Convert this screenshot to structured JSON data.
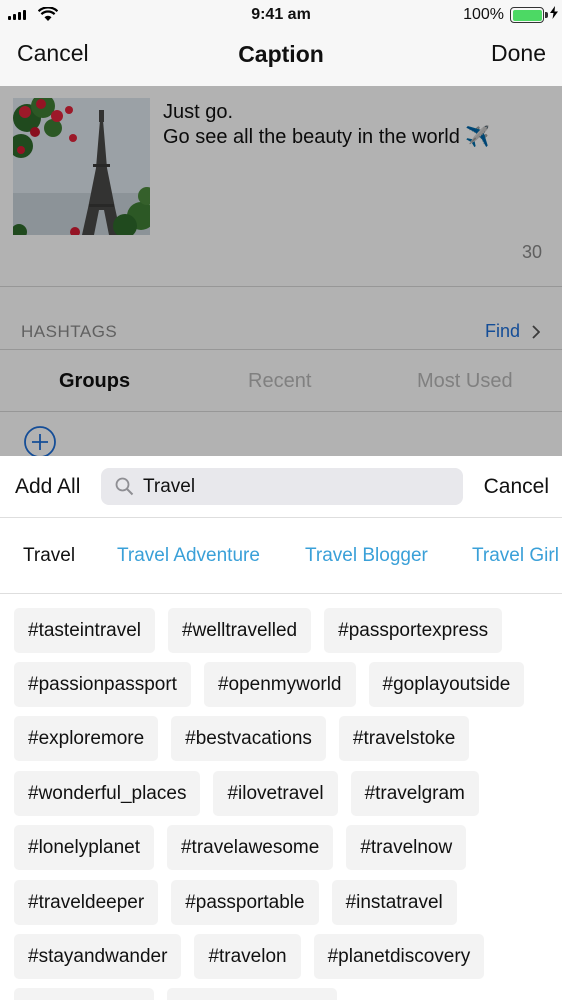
{
  "status_bar": {
    "time": "9:41 am",
    "battery_percent": "100%",
    "battery_level": 1.0
  },
  "nav": {
    "cancel_label": "Cancel",
    "title": "Caption",
    "done_label": "Done"
  },
  "caption": {
    "lines": [
      "Just go.",
      "Go see all the beauty in the world ✈️"
    ],
    "char_count": "30"
  },
  "hashtags_section": {
    "label": "HASHTAGS",
    "find_label": "Find",
    "tabs": [
      "Groups",
      "Recent",
      "Most Used"
    ],
    "active_tab": "Groups"
  },
  "search": {
    "add_all_label": "Add All",
    "value": "Travel",
    "cancel_label": "Cancel"
  },
  "categories": [
    "Travel",
    "Travel Adventure",
    "Travel Blogger",
    "Travel Girl"
  ],
  "active_category": "Travel",
  "hashtag_rows": [
    [
      "#tasteintravel",
      "#welltravelled",
      "#passportexpress"
    ],
    [
      "#passionpassport",
      "#openmyworld",
      "#goplayoutside"
    ],
    [
      "#exploremore",
      "#bestvacations",
      "#travelstoke"
    ],
    [
      "#wonderful_places",
      "#ilovetravel",
      "#travelgram"
    ],
    [
      "#lonelyplanet",
      "#travelawesome",
      "#travelnow"
    ],
    [
      "#traveldeeper",
      "#passportable",
      "#instatravel"
    ],
    [
      "#stayandwander",
      "#travelon",
      "#planetdiscovery"
    ]
  ],
  "colors": {
    "accent": "#1e6fd9",
    "category_link": "#3aa0d8",
    "battery": "#4cd964"
  },
  "icons": [
    "signal-icon",
    "wifi-icon",
    "battery-icon",
    "charging-bolt-icon",
    "chevron-right-icon",
    "add-circle-icon",
    "search-icon"
  ]
}
